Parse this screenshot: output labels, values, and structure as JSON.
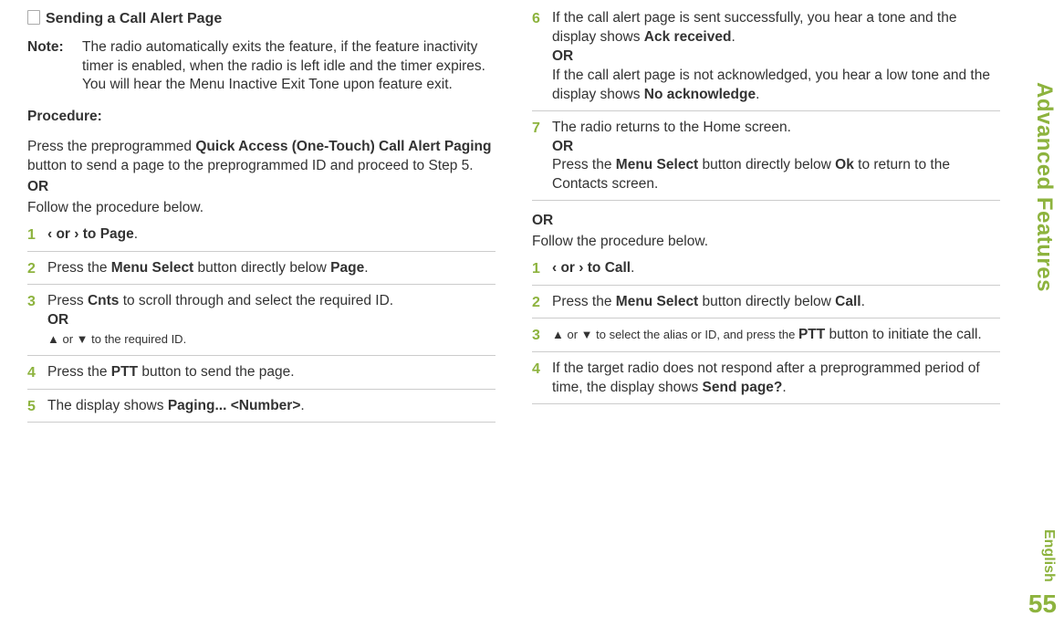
{
  "sideTab": "Advanced Features",
  "lang": "English",
  "pageNum": "55",
  "heading": "Sending a Call Alert Page",
  "noteLabel": "Note:",
  "noteText": "The radio automatically exits the feature, if the feature inactivity timer is enabled, when the radio is left idle and the timer expires. You will hear the Menu Inactive Exit Tone upon feature exit.",
  "procLabel": "Procedure:",
  "intro1a": "Press the preprogrammed ",
  "intro1b": "Quick Access (One-Touch) Call Alert Paging",
  "intro1c": " button to send a page to the preprogrammed ID and proceed to Step 5.",
  "OR": "OR",
  "intro2": "Follow the procedure below.",
  "left": {
    "s1": {
      "n": "1",
      "a": "‹ or › to ",
      "ui": "Page",
      "c": "."
    },
    "s2": {
      "n": "2",
      "a": "Press the ",
      "b": "Menu Select",
      "a2": " button directly below ",
      "ui": "Page",
      "c": "."
    },
    "s3": {
      "n": "3",
      "a": "Press ",
      "ui": "Cnts",
      "a2": " to scroll through and select the required ID.",
      "or": "OR",
      "b": "▲ or ▼ to the required ID."
    },
    "s4": {
      "n": "4",
      "a": "Press the ",
      "b": "PTT",
      "a2": " button to send the page."
    },
    "s5": {
      "n": "5",
      "a": "The display shows ",
      "ui": "Paging... <Number>",
      "c": "."
    }
  },
  "right": {
    "s6": {
      "n": "6",
      "a": "If the call alert page is sent successfully, you hear a tone and the display shows ",
      "ui1": "Ack received",
      "c1": ".",
      "or": "OR",
      "b": "If the call alert page is not acknowledged, you hear a low tone and the display shows ",
      "ui2": "No acknowledge",
      "c2": "."
    },
    "s7": {
      "n": "7",
      "a": "The radio returns to the Home screen.",
      "or": "OR",
      "b1": "Press the ",
      "bold": "Menu Select",
      "b2": " button directly below ",
      "ui": "Ok",
      "b3": " to return to the Contacts screen."
    },
    "post1": "OR",
    "post2": "Follow the procedure below.",
    "s1": {
      "n": "1",
      "a": "‹ or › to ",
      "ui": "Call",
      "c": "."
    },
    "s2": {
      "n": "2",
      "a": "Press the ",
      "b": "Menu Select",
      "a2": " button directly below ",
      "ui": "Call",
      "c": "."
    },
    "s3": {
      "n": "3",
      "a": "▲ or ▼ to select the alias or ID, and press the ",
      "b": "PTT",
      "a2": " button to initiate the call."
    },
    "s4": {
      "n": "4",
      "a": "If the target radio does not respond after a preprogrammed period of time, the display shows ",
      "ui": "Send page?",
      "c": "."
    }
  }
}
